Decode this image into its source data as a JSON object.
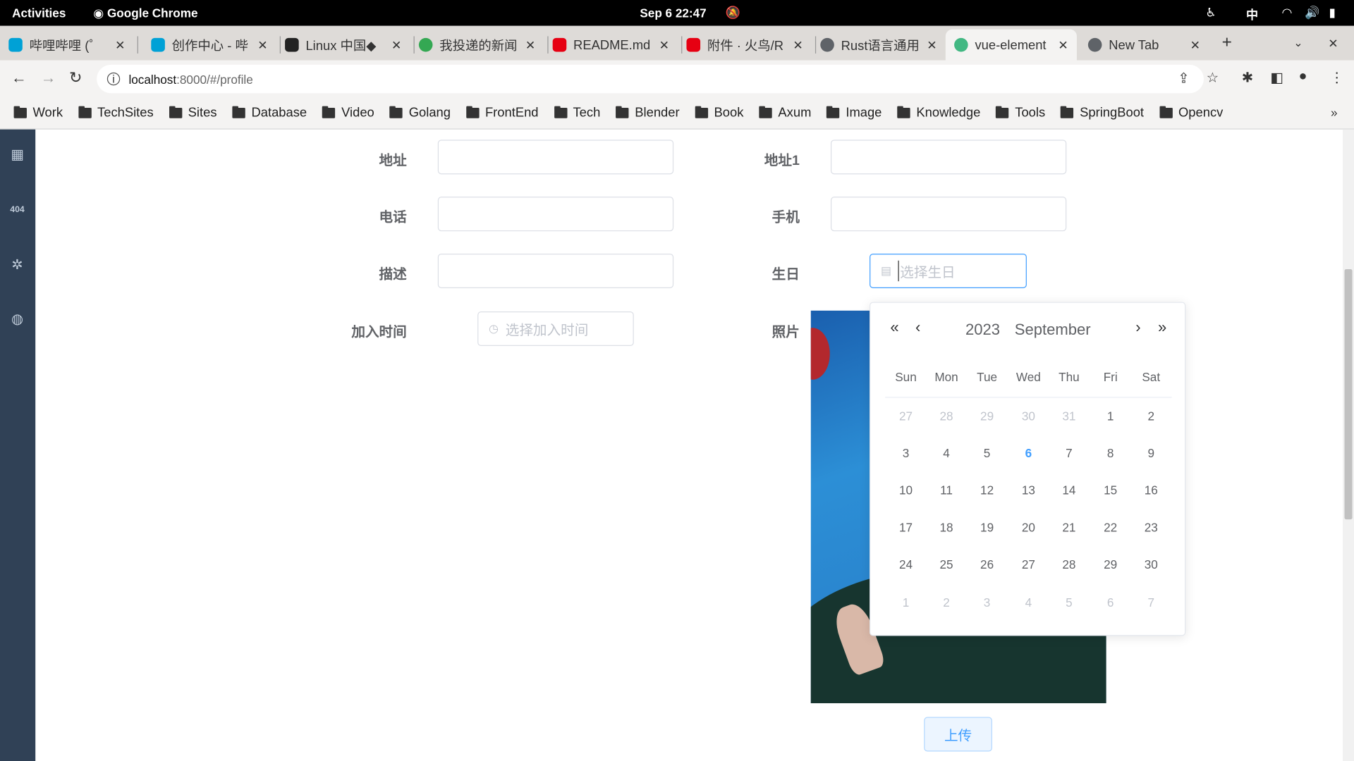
{
  "system_bar": {
    "activities": "Activities",
    "app": "Google Chrome",
    "datetime": "Sep 6  22:47",
    "ime": "中"
  },
  "tabs": [
    {
      "title": "哔哩哔哩 (゜",
      "icon": "bilibili-icon",
      "color": "#00a1d6"
    },
    {
      "title": "创作中心 - 哔",
      "icon": "bilibili-icon",
      "color": "#00a1d6"
    },
    {
      "title": "Linux 中国◆",
      "icon": "linux-cn-icon",
      "color": "#222222"
    },
    {
      "title": "我投递的新闻",
      "icon": "c-icon",
      "color": "#34a853"
    },
    {
      "title": "README.md",
      "icon": "gitee-icon",
      "color": "#e60012"
    },
    {
      "title": "附件 · 火鸟/R",
      "icon": "gitee-icon",
      "color": "#e60012"
    },
    {
      "title": "Rust语言通用",
      "icon": "globe-icon",
      "color": "#5f6368"
    },
    {
      "title": "vue-element",
      "icon": "vue-icon",
      "color": "#42b883",
      "active": true
    },
    {
      "title": "New Tab",
      "icon": "chrome-icon",
      "color": "#5f6368"
    }
  ],
  "address": {
    "host": "localhost",
    "rest": ":8000/#/profile"
  },
  "bookmarks": [
    "Work",
    "TechSites",
    "Sites",
    "Database",
    "Video",
    "Golang",
    "FrontEnd",
    "Tech",
    "Blender",
    "Book",
    "Axum",
    "Image",
    "Knowledge",
    "Tools",
    "SpringBoot",
    "Opencv"
  ],
  "form": {
    "address_label": "地址",
    "address1_label": "地址1",
    "phone_label": "电话",
    "mobile_label": "手机",
    "desc_label": "描述",
    "birthday_label": "生日",
    "join_label": "加入时间",
    "photo_label": "照片",
    "birthday_placeholder": "选择生日",
    "join_placeholder": "选择加入时间",
    "upload": "上传"
  },
  "calendar": {
    "year": "2023",
    "month": "September",
    "weekdays": [
      "Sun",
      "Mon",
      "Tue",
      "Wed",
      "Thu",
      "Fri",
      "Sat"
    ],
    "today": 6,
    "weeks": [
      [
        {
          "d": "27",
          "m": true
        },
        {
          "d": "28",
          "m": true
        },
        {
          "d": "29",
          "m": true
        },
        {
          "d": "30",
          "m": true
        },
        {
          "d": "31",
          "m": true
        },
        {
          "d": "1"
        },
        {
          "d": "2"
        }
      ],
      [
        {
          "d": "3"
        },
        {
          "d": "4"
        },
        {
          "d": "5"
        },
        {
          "d": "6",
          "t": true
        },
        {
          "d": "7"
        },
        {
          "d": "8"
        },
        {
          "d": "9"
        }
      ],
      [
        {
          "d": "10"
        },
        {
          "d": "11"
        },
        {
          "d": "12"
        },
        {
          "d": "13"
        },
        {
          "d": "14"
        },
        {
          "d": "15"
        },
        {
          "d": "16"
        }
      ],
      [
        {
          "d": "17"
        },
        {
          "d": "18"
        },
        {
          "d": "19"
        },
        {
          "d": "20"
        },
        {
          "d": "21"
        },
        {
          "d": "22"
        },
        {
          "d": "23"
        }
      ],
      [
        {
          "d": "24"
        },
        {
          "d": "25"
        },
        {
          "d": "26"
        },
        {
          "d": "27"
        },
        {
          "d": "28"
        },
        {
          "d": "29"
        },
        {
          "d": "30"
        }
      ],
      [
        {
          "d": "1",
          "m": true
        },
        {
          "d": "2",
          "m": true
        },
        {
          "d": "3",
          "m": true
        },
        {
          "d": "4",
          "m": true
        },
        {
          "d": "5",
          "m": true
        },
        {
          "d": "6",
          "m": true
        },
        {
          "d": "7",
          "m": true
        }
      ]
    ]
  },
  "colors": {
    "primary": "#409eff",
    "sidebar": "#304156"
  }
}
